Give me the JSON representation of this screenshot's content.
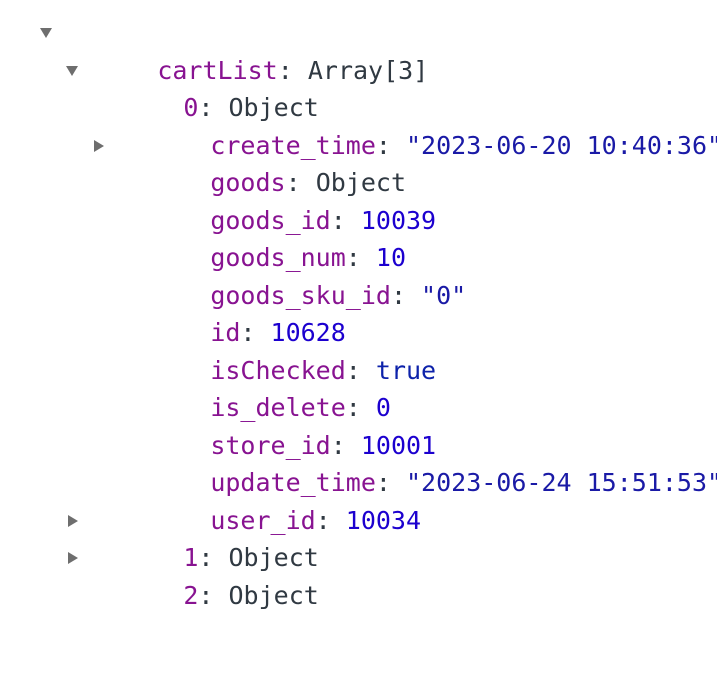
{
  "root": {
    "key": "cartList",
    "sep": ": ",
    "value": "Array[3]"
  },
  "item0": {
    "key": "0",
    "sep": ": ",
    "value": "Object",
    "fields": [
      {
        "key": "create_time",
        "sep": ": ",
        "value": "\"2023-06-20 10:40:36\"",
        "type": "string",
        "expandable": false
      },
      {
        "key": "goods",
        "sep": ": ",
        "value": "Object",
        "type": "object",
        "expandable": true
      },
      {
        "key": "goods_id",
        "sep": ": ",
        "value": "10039",
        "type": "number",
        "expandable": false
      },
      {
        "key": "goods_num",
        "sep": ": ",
        "value": "10",
        "type": "number",
        "expandable": false
      },
      {
        "key": "goods_sku_id",
        "sep": ": ",
        "value": "\"0\"",
        "type": "string",
        "expandable": false
      },
      {
        "key": "id",
        "sep": ": ",
        "value": "10628",
        "type": "number",
        "expandable": false
      },
      {
        "key": "isChecked",
        "sep": ": ",
        "value": "true",
        "type": "boolean",
        "expandable": false
      },
      {
        "key": "is_delete",
        "sep": ": ",
        "value": "0",
        "type": "number",
        "expandable": false
      },
      {
        "key": "store_id",
        "sep": ": ",
        "value": "10001",
        "type": "number",
        "expandable": false
      },
      {
        "key": "update_time",
        "sep": ": ",
        "value": "\"2023-06-24 15:51:53\"",
        "type": "string",
        "expandable": false
      },
      {
        "key": "user_id",
        "sep": ": ",
        "value": "10034",
        "type": "number",
        "expandable": false
      }
    ]
  },
  "item1": {
    "key": "1",
    "sep": ": ",
    "value": "Object"
  },
  "item2": {
    "key": "2",
    "sep": ": ",
    "value": "Object"
  },
  "colors": {
    "key": "#881391",
    "string": "#1a1aa6",
    "number": "#1c00cf",
    "boolean": "#0d22aa",
    "text": "#303942",
    "arrow": "#6e6e6e"
  }
}
